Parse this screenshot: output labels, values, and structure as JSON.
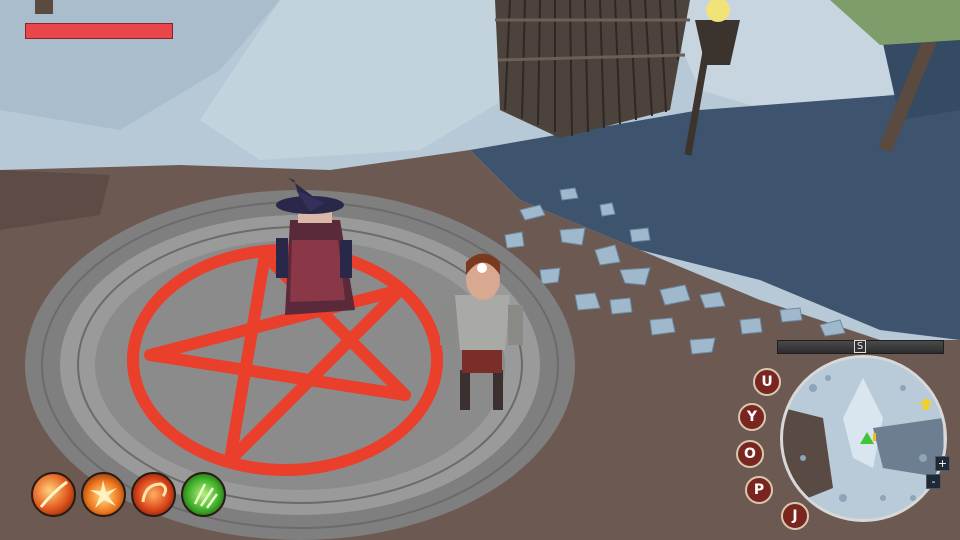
{
  "hud": {
    "health_fraction": 1.0,
    "health_color": "#e8464a",
    "compass_letter": "S",
    "menu_buttons": [
      {
        "label": "U",
        "icon": "u-magnet-icon"
      },
      {
        "label": "Y",
        "icon": "y-skills-icon"
      },
      {
        "label": "O",
        "icon": "o-gear-icon"
      },
      {
        "label": "P",
        "icon": "p-profile-icon"
      },
      {
        "label": "J",
        "icon": "j-journal-icon"
      }
    ],
    "minimap_zoom_in": "+",
    "minimap_zoom_out": "-",
    "skills": [
      {
        "icon": "fire-slash-icon",
        "color": "#e2561b"
      },
      {
        "icon": "fire-burst-icon",
        "color": "#f07a20"
      },
      {
        "icon": "fire-swirl-icon",
        "color": "#d9441a"
      },
      {
        "icon": "green-poison-icon",
        "color": "#3fae2a"
      }
    ]
  },
  "colors": {
    "ground": "#6b5a52",
    "ice": "#b9cbd8",
    "water": "#3f5570",
    "stone": "#8f8f8f",
    "pentagram": "#ea3f2a"
  }
}
